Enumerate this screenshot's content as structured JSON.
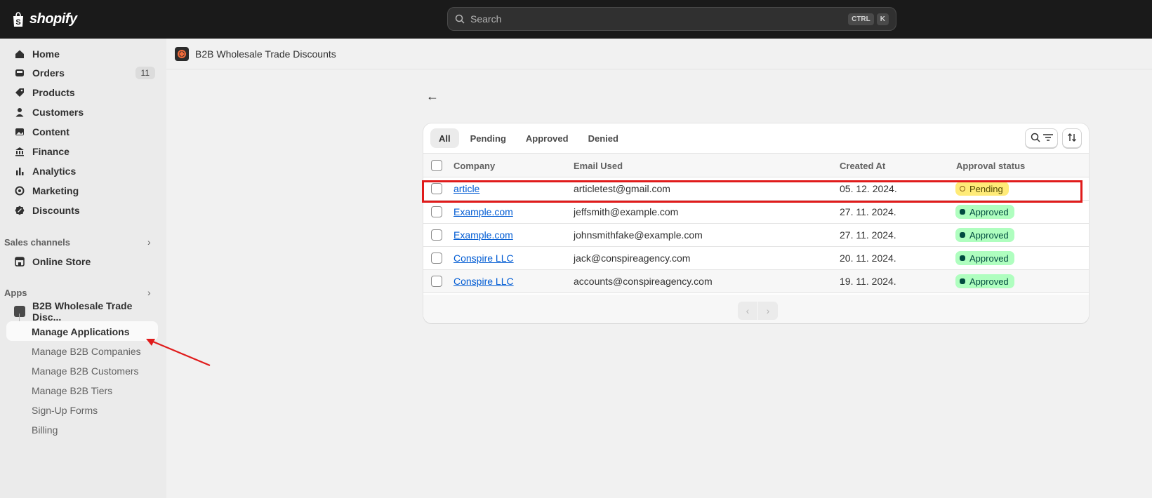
{
  "topbar": {
    "logo_text": "shopify",
    "search_placeholder": "Search",
    "shortcut_ctrl": "CTRL",
    "shortcut_k": "K"
  },
  "sidebar": {
    "items": [
      {
        "label": "Home",
        "icon": "home-icon"
      },
      {
        "label": "Orders",
        "icon": "inbox-icon",
        "badge": "11"
      },
      {
        "label": "Products",
        "icon": "tag-icon"
      },
      {
        "label": "Customers",
        "icon": "person-icon"
      },
      {
        "label": "Content",
        "icon": "image-icon"
      },
      {
        "label": "Finance",
        "icon": "bank-icon"
      },
      {
        "label": "Analytics",
        "icon": "bar-chart-icon"
      },
      {
        "label": "Marketing",
        "icon": "target-icon"
      },
      {
        "label": "Discounts",
        "icon": "discount-icon"
      }
    ],
    "sales_channels_title": "Sales channels",
    "online_store": "Online Store",
    "apps_title": "Apps",
    "app_name": "B2B Wholesale Trade Disc...",
    "app_subitems": [
      "Manage Applications",
      "Manage B2B Companies",
      "Manage B2B Customers",
      "Manage B2B Tiers",
      "Sign-Up Forms",
      "Billing"
    ]
  },
  "appbar": {
    "title": "B2B Wholesale Trade Discounts"
  },
  "tabs": [
    "All",
    "Pending",
    "Approved",
    "Denied"
  ],
  "table": {
    "headers": [
      "Company",
      "Email Used",
      "Created At",
      "Approval status"
    ],
    "rows": [
      {
        "company": "article",
        "email": "articletest@gmail.com",
        "created": "05. 12. 2024.",
        "status": "Pending"
      },
      {
        "company": "Example.com",
        "email": "jeffsmith@example.com",
        "created": "27. 11. 2024.",
        "status": "Approved"
      },
      {
        "company": "Example.com",
        "email": "johnsmithfake@example.com",
        "created": "27. 11. 2024.",
        "status": "Approved"
      },
      {
        "company": "Conspire LLC",
        "email": "jack@conspireagency.com",
        "created": "20. 11. 2024.",
        "status": "Approved"
      },
      {
        "company": "Conspire LLC",
        "email": "accounts@conspireagency.com",
        "created": "19. 11. 2024.",
        "status": "Approved"
      }
    ]
  },
  "colors": {
    "highlight": "#e01b1b",
    "link": "#005bd3",
    "pending_bg": "#ffeb78",
    "approved_bg": "#affebf"
  }
}
